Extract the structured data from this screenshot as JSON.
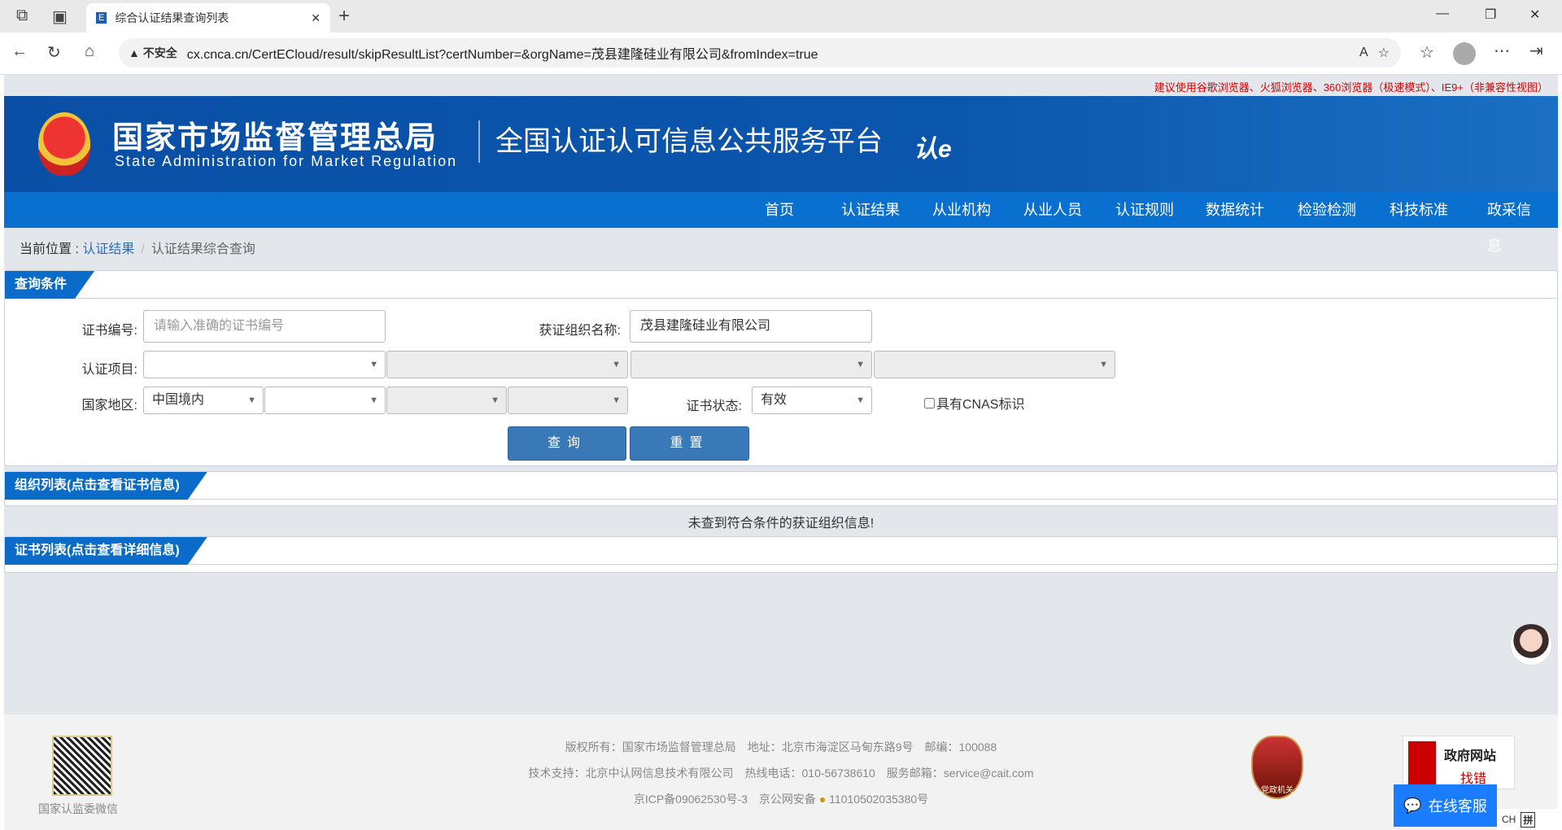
{
  "browser": {
    "tab_title": "综合认证结果查询列表",
    "security": "不安全",
    "url": "cx.cnca.cn/CertECloud/result/skipResultList?certNumber=&orgName=茂县建隆硅业有限公司&fromIndex=true"
  },
  "notice": "建议使用谷歌浏览器、火狐浏览器、360浏览器（极速模式）、IE9+（非兼容性视图）",
  "header": {
    "org_cn": "国家市场监督管理总局",
    "org_en": "State Administration for Market Regulation",
    "platform": "全国认证认可信息公共服务平台",
    "logo_text": "认e云"
  },
  "nav": [
    "首页",
    "认证结果",
    "从业机构",
    "从业人员",
    "认证规则",
    "数据统计",
    "检验检测",
    "科技标准",
    "政采信息"
  ],
  "breadcrumb": {
    "prefix": "当前位置 : ",
    "link": "认证结果",
    "sep": "/",
    "current": "认证结果综合查询"
  },
  "query": {
    "title": "查询条件",
    "cert_no_label": "证书编号:",
    "cert_no_placeholder": "请输入准确的证书编号",
    "org_label": "获证组织名称:",
    "org_value": "茂县建隆硅业有限公司",
    "project_label": "认证项目:",
    "region_label": "国家地区:",
    "region_value": "中国境内",
    "status_label": "证书状态:",
    "status_value": "有效",
    "cnas_label": "具有CNAS标识",
    "search": "查询",
    "reset": "重置"
  },
  "org_list": {
    "title": "组织列表(点击查看证书信息)",
    "empty": "未查到符合条件的获证组织信息!"
  },
  "cert_list": {
    "title": "证书列表(点击查看详细信息)"
  },
  "footer": {
    "line1": "版权所有：国家市场监督管理总局　地址：北京市海淀区马甸东路9号　邮编：100088",
    "line2": "技术支持：北京中认网信息技术有限公司　热线电话：010-56738610　服务邮箱：service@cait.com",
    "line3a": "京ICP备09062530号-3　京公网安备",
    "line3b": "11010502035380号",
    "qr_label": "国家认监委微信",
    "gov_badge": "党政机关",
    "gov_site": "政府网站",
    "gov_find": "找错",
    "chat": "在线客服"
  },
  "colors": {
    "nav": "#0970d0",
    "banner": "#0b56ad",
    "button": "#3a79b8"
  }
}
